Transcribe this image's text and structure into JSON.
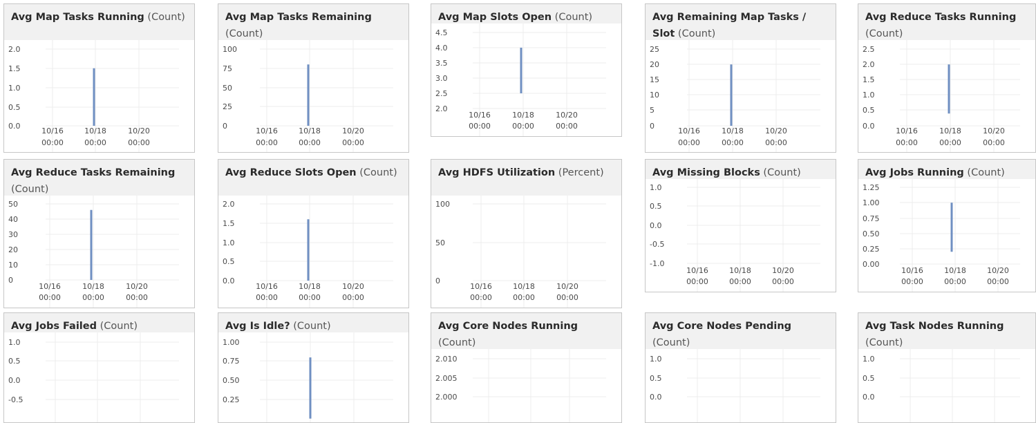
{
  "charts": [
    {
      "title": "Avg Map Tasks Running",
      "unit": "(Count)",
      "y_ticks": [
        "2.0",
        "1.5",
        "1.0",
        "0.5",
        "0.0"
      ],
      "x_ticks": [
        [
          "10/16",
          "00:00"
        ],
        [
          "10/18",
          "00:00"
        ],
        [
          "10/20",
          "00:00"
        ]
      ],
      "series_color": "#6f8fc2",
      "chart_data": {
        "type": "line",
        "series": [
          {
            "values": [
              [
                0.0,
                1.5
              ]
            ]
          }
        ],
        "ylim": [
          0,
          2.0
        ],
        "spike_x": "10/18"
      }
    },
    {
      "title": "Avg Map Tasks Remaining",
      "unit": "(Count)",
      "y_ticks": [
        "100",
        "75",
        "50",
        "25",
        "0"
      ],
      "x_ticks": [
        [
          "10/16",
          "00:00"
        ],
        [
          "10/18",
          "00:00"
        ],
        [
          "10/20",
          "00:00"
        ]
      ],
      "series_color": "#6f8fc2",
      "chart_data": {
        "type": "line",
        "series": [
          {
            "values": [
              [
                0,
                80
              ]
            ]
          }
        ],
        "ylim": [
          0,
          100
        ],
        "spike_x": "10/18"
      }
    },
    {
      "title": "Avg Map Slots Open",
      "unit": "(Count)",
      "y_ticks": [
        "4.5",
        "4.0",
        "3.5",
        "3.0",
        "2.5",
        "2.0"
      ],
      "x_ticks": [
        [
          "10/16",
          "00:00"
        ],
        [
          "10/18",
          "00:00"
        ],
        [
          "10/20",
          "00:00"
        ]
      ],
      "series_color": "#6f8fc2",
      "chart_data": {
        "type": "line",
        "series": [
          {
            "values": [
              [
                2.5,
                4.0
              ]
            ]
          }
        ],
        "ylim": [
          2.0,
          4.5
        ],
        "spike_x": "10/18"
      }
    },
    {
      "title": "Avg Remaining Map Tasks / Slot",
      "unit": "(Count)",
      "y_ticks": [
        "25",
        "20",
        "15",
        "10",
        "5",
        "0"
      ],
      "x_ticks": [
        [
          "10/16",
          "00:00"
        ],
        [
          "10/18",
          "00:00"
        ],
        [
          "10/20",
          "00:00"
        ]
      ],
      "series_color": "#6f8fc2",
      "chart_data": {
        "type": "line",
        "series": [
          {
            "values": [
              [
                0,
                20
              ]
            ]
          }
        ],
        "ylim": [
          0,
          25
        ],
        "spike_x": "10/18"
      }
    },
    {
      "title": "Avg Reduce Tasks Running",
      "unit": "(Count)",
      "y_ticks": [
        "2.5",
        "2.0",
        "1.5",
        "1.0",
        "0.5",
        "0.0"
      ],
      "x_ticks": [
        [
          "10/16",
          "00:00"
        ],
        [
          "10/18",
          "00:00"
        ],
        [
          "10/20",
          "00:00"
        ]
      ],
      "series_color": "#6f8fc2",
      "chart_data": {
        "type": "line",
        "series": [
          {
            "values": [
              [
                0.4,
                2.0
              ]
            ]
          }
        ],
        "ylim": [
          0,
          2.5
        ],
        "spike_x": "10/18"
      }
    },
    {
      "title": "Avg Reduce Tasks Remaining",
      "unit": "(Count)",
      "y_ticks": [
        "50",
        "40",
        "30",
        "20",
        "10",
        "0"
      ],
      "x_ticks": [
        [
          "10/16",
          "00:00"
        ],
        [
          "10/18",
          "00:00"
        ],
        [
          "10/20",
          "00:00"
        ]
      ],
      "series_color": "#6f8fc2",
      "chart_data": {
        "type": "line",
        "series": [
          {
            "values": [
              [
                0,
                46
              ]
            ]
          }
        ],
        "ylim": [
          0,
          50
        ],
        "spike_x": "10/18"
      }
    },
    {
      "title": "Avg Reduce Slots Open",
      "unit": "(Count)",
      "y_ticks": [
        "2.0",
        "1.5",
        "1.0",
        "0.5",
        "0.0"
      ],
      "x_ticks": [
        [
          "10/16",
          "00:00"
        ],
        [
          "10/18",
          "00:00"
        ],
        [
          "10/20",
          "00:00"
        ]
      ],
      "series_color": "#6f8fc2",
      "chart_data": {
        "type": "line",
        "series": [
          {
            "values": [
              [
                0.0,
                1.6
              ]
            ]
          }
        ],
        "ylim": [
          0,
          2.0
        ],
        "spike_x": "10/18"
      }
    },
    {
      "title": "Avg HDFS Utilization",
      "unit": "(Percent)",
      "y_ticks": [
        "100",
        "50",
        "0"
      ],
      "x_ticks": [
        [
          "10/16",
          "00:00"
        ],
        [
          "10/18",
          "00:00"
        ],
        [
          "10/20",
          "00:00"
        ]
      ],
      "series_color": "#6f8fc2",
      "chart_data": {
        "type": "line",
        "series": [
          {
            "values": []
          }
        ],
        "ylim": [
          0,
          100
        ]
      }
    },
    {
      "title": "Avg Missing Blocks",
      "unit": "(Count)",
      "y_ticks": [
        "1.0",
        "0.5",
        "0.0",
        "-0.5",
        "-1.0"
      ],
      "x_ticks": [
        [
          "10/16",
          "00:00"
        ],
        [
          "10/18",
          "00:00"
        ],
        [
          "10/20",
          "00:00"
        ]
      ],
      "series_color": "#6f8fc2",
      "chart_data": {
        "type": "line",
        "series": [
          {
            "values": []
          }
        ],
        "ylim": [
          -1.0,
          1.0
        ]
      }
    },
    {
      "title": "Avg Jobs Running",
      "unit": "(Count)",
      "y_ticks": [
        "1.25",
        "1.00",
        "0.75",
        "0.50",
        "0.25",
        "0.00"
      ],
      "x_ticks": [
        [
          "10/16",
          "00:00"
        ],
        [
          "10/18",
          "00:00"
        ],
        [
          "10/20",
          "00:00"
        ]
      ],
      "series_color": "#6f8fc2",
      "chart_data": {
        "type": "line",
        "series": [
          {
            "values": [
              [
                0.2,
                1.0
              ]
            ]
          }
        ],
        "ylim": [
          0,
          1.25
        ],
        "spike_x": "10/18"
      }
    },
    {
      "title": "Avg Jobs Failed",
      "unit": "(Count)",
      "y_ticks": [
        "1.0",
        "0.5",
        "0.0",
        "-0.5"
      ],
      "x_ticks": [],
      "series_color": "#6f8fc2",
      "chart_data": {
        "type": "line",
        "series": [
          {
            "values": []
          }
        ],
        "ylim": [
          -1.0,
          1.0
        ]
      }
    },
    {
      "title": "Avg Is Idle?",
      "unit": "(Count)",
      "y_ticks": [
        "1.00",
        "0.75",
        "0.50",
        "0.25"
      ],
      "x_ticks": [],
      "series_color": "#6f8fc2",
      "chart_data": {
        "type": "line",
        "series": [
          {
            "values": [
              [
                0.0,
                0.8
              ]
            ]
          }
        ],
        "ylim": [
          0,
          1.0
        ],
        "spike_x": "10/18"
      }
    },
    {
      "title": "Avg Core Nodes Running",
      "unit": "(Count)",
      "y_ticks": [
        "2.010",
        "2.005",
        "2.000"
      ],
      "x_ticks": [],
      "series_color": "#6f8fc2",
      "chart_data": {
        "type": "line",
        "series": [
          {
            "values": []
          }
        ],
        "ylim": [
          1.995,
          2.01
        ]
      }
    },
    {
      "title": "Avg Core Nodes Pending",
      "unit": "(Count)",
      "y_ticks": [
        "1.0",
        "0.5",
        "0.0"
      ],
      "x_ticks": [],
      "series_color": "#6f8fc2",
      "chart_data": {
        "type": "line",
        "series": [
          {
            "values": []
          }
        ],
        "ylim": [
          -0.5,
          1.0
        ]
      }
    },
    {
      "title": "Avg Task Nodes Running",
      "unit": "(Count)",
      "y_ticks": [
        "1.0",
        "0.5",
        "0.0"
      ],
      "x_ticks": [],
      "series_color": "#6f8fc2",
      "chart_data": {
        "type": "line",
        "series": [
          {
            "values": []
          }
        ],
        "ylim": [
          -0.5,
          1.0
        ]
      }
    }
  ]
}
